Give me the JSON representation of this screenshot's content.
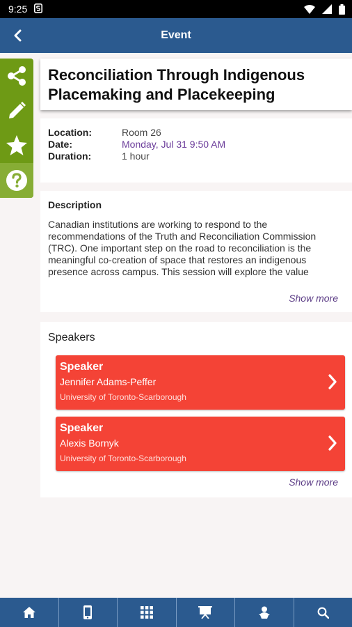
{
  "status_bar": {
    "time": "9:25",
    "icons": [
      "s-app-icon",
      "wifi-icon",
      "signal-icon",
      "battery-icon"
    ]
  },
  "app_bar": {
    "title": "Event",
    "back_icon": "chevron-left-icon"
  },
  "side_actions": [
    {
      "icon": "share-icon"
    },
    {
      "icon": "edit-icon"
    },
    {
      "icon": "star-icon"
    },
    {
      "icon": "help-icon"
    }
  ],
  "event": {
    "title": "Reconciliation Through Indigenous Placemaking and Placekeeping",
    "location_label": "Location:",
    "location": "Room 26",
    "date_label": "Date:",
    "date": "Monday, Jul 31 9:50 AM",
    "duration_label": "Duration:",
    "duration": "1 hour"
  },
  "description": {
    "heading": "Description",
    "text": "Canadian institutions are working to respond to the recommendations of the Truth and Reconciliation Commission (TRC). One important step on the road to reconciliation is the meaningful co-creation of space that restores an indigenous presence across campus. This session will explore the value proposition of 'living the intent of reconciliation' and share the",
    "show_more": "Show more"
  },
  "speakers": {
    "heading": "Speakers",
    "items": [
      {
        "role": "Speaker",
        "name": "Jennifer Adams-Peffer",
        "org": "University of Toronto-Scarborough"
      },
      {
        "role": "Speaker",
        "name": "Alexis Bornyk",
        "org": "University of Toronto-Scarborough"
      }
    ],
    "show_more": "Show more"
  },
  "bottom_nav": [
    {
      "icon": "home-icon"
    },
    {
      "icon": "phone-icon"
    },
    {
      "icon": "grid-icon"
    },
    {
      "icon": "presentation-icon"
    },
    {
      "icon": "person-icon"
    },
    {
      "icon": "search-icon"
    }
  ],
  "colors": {
    "app_bar": "#2b5a8f",
    "side_actions": "#6e9a15",
    "speaker_card": "#f44336",
    "date_text": "#6b3c9a"
  }
}
